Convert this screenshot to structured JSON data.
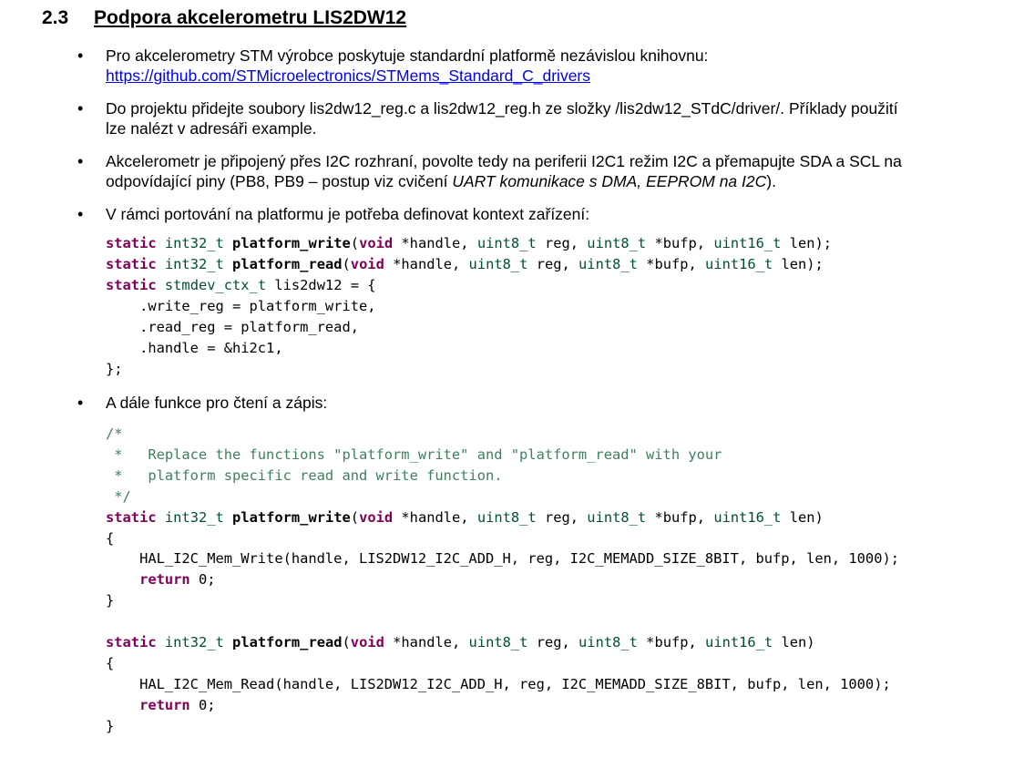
{
  "section": {
    "number": "2.3",
    "title": "Podpora akcelerometru LIS2DW12"
  },
  "bullet_glyph": "•",
  "bullets": [
    {
      "line1": "Pro akcelerometry STM výrobce poskytuje standardní platformě nezávislou knihovnu:",
      "link": "https://github.com/STMicroelectronics/STMems_Standard_C_drivers"
    },
    {
      "line1": "Do projektu přidejte soubory lis2dw12_reg.c a lis2dw12_reg.h ze složky /lis2dw12_STdC/driver/. Příklady použití",
      "line2": "lze nalézt v adresáři example."
    },
    {
      "line1": "Akcelerometr je připojený přes I2C rozhraní, povolte tedy na periferii I2C1 režim I2C a přemapujte SDA a SCL na",
      "line2_pre": "odpovídající piny (PB8, PB9 – postup viz cvičení ",
      "line2_em": "UART komunikace s DMA, EEPROM na I2C",
      "line2_post": ")."
    },
    {
      "line1": "V rámci portování na platformu je potřeba definovat kontext zařízení:"
    },
    {
      "line1": "A dále funkce pro čtení a zápis:"
    }
  ],
  "code1": [
    [
      [
        "static",
        "kw"
      ],
      [
        " ",
        ""
      ],
      [
        "int32_t",
        "ty"
      ],
      [
        " ",
        ""
      ],
      [
        "platform_write",
        "fn"
      ],
      [
        "(",
        ""
      ],
      [
        "void",
        "kw"
      ],
      [
        " *handle, ",
        ""
      ],
      [
        "uint8_t",
        "ty"
      ],
      [
        " reg, ",
        ""
      ],
      [
        "uint8_t",
        "ty"
      ],
      [
        " *bufp, ",
        ""
      ],
      [
        "uint16_t",
        "ty"
      ],
      [
        " len);",
        ""
      ]
    ],
    [
      [
        "static",
        "kw"
      ],
      [
        " ",
        ""
      ],
      [
        "int32_t",
        "ty"
      ],
      [
        " ",
        ""
      ],
      [
        "platform_read",
        "fn"
      ],
      [
        "(",
        ""
      ],
      [
        "void",
        "kw"
      ],
      [
        " *handle, ",
        ""
      ],
      [
        "uint8_t",
        "ty"
      ],
      [
        " reg, ",
        ""
      ],
      [
        "uint8_t",
        "ty"
      ],
      [
        " *bufp, ",
        ""
      ],
      [
        "uint16_t",
        "ty"
      ],
      [
        " len);",
        ""
      ]
    ],
    [
      [
        "static",
        "kw"
      ],
      [
        " ",
        ""
      ],
      [
        "stmdev_ctx_t",
        "ty"
      ],
      [
        " lis2dw12 = {",
        ""
      ]
    ],
    [
      [
        "    .write_reg = platform_write,",
        ""
      ]
    ],
    [
      [
        "    .read_reg = platform_read,",
        ""
      ]
    ],
    [
      [
        "    .handle = &hi2c1,",
        ""
      ]
    ],
    [
      [
        "};",
        ""
      ]
    ]
  ],
  "code2": [
    [
      [
        "/*",
        "cm"
      ]
    ],
    [
      [
        " *   Replace the functions \"platform_write\" and \"platform_read\" with your",
        "cm"
      ]
    ],
    [
      [
        " *   platform specific read and write function.",
        "cm"
      ]
    ],
    [
      [
        " */",
        "cm"
      ]
    ],
    [
      [
        "static",
        "kw"
      ],
      [
        " ",
        ""
      ],
      [
        "int32_t",
        "ty"
      ],
      [
        " ",
        ""
      ],
      [
        "platform_write",
        "fn"
      ],
      [
        "(",
        ""
      ],
      [
        "void",
        "kw"
      ],
      [
        " *handle, ",
        ""
      ],
      [
        "uint8_t",
        "ty"
      ],
      [
        " reg, ",
        ""
      ],
      [
        "uint8_t",
        "ty"
      ],
      [
        " *bufp, ",
        ""
      ],
      [
        "uint16_t",
        "ty"
      ],
      [
        " len)",
        ""
      ]
    ],
    [
      [
        "{",
        ""
      ]
    ],
    [
      [
        "    HAL_I2C_Mem_Write(handle, LIS2DW12_I2C_ADD_H, reg, I2C_MEMADD_SIZE_8BIT, bufp, len, 1000);",
        ""
      ]
    ],
    [
      [
        "    ",
        ""
      ],
      [
        "return",
        "kw"
      ],
      [
        " 0;",
        ""
      ]
    ],
    [
      [
        "}",
        ""
      ]
    ],
    [
      [
        "",
        ""
      ]
    ],
    [
      [
        "static",
        "kw"
      ],
      [
        " ",
        ""
      ],
      [
        "int32_t",
        "ty"
      ],
      [
        " ",
        ""
      ],
      [
        "platform_read",
        "fn"
      ],
      [
        "(",
        ""
      ],
      [
        "void",
        "kw"
      ],
      [
        " *handle, ",
        ""
      ],
      [
        "uint8_t",
        "ty"
      ],
      [
        " reg, ",
        ""
      ],
      [
        "uint8_t",
        "ty"
      ],
      [
        " *bufp, ",
        ""
      ],
      [
        "uint16_t",
        "ty"
      ],
      [
        " len)",
        ""
      ]
    ],
    [
      [
        "{",
        ""
      ]
    ],
    [
      [
        "    HAL_I2C_Mem_Read(handle, LIS2DW12_I2C_ADD_H, reg, I2C_MEMADD_SIZE_8BIT, bufp, len, 1000);",
        ""
      ]
    ],
    [
      [
        "    ",
        ""
      ],
      [
        "return",
        "kw"
      ],
      [
        " 0;",
        ""
      ]
    ],
    [
      [
        "}",
        ""
      ]
    ]
  ]
}
